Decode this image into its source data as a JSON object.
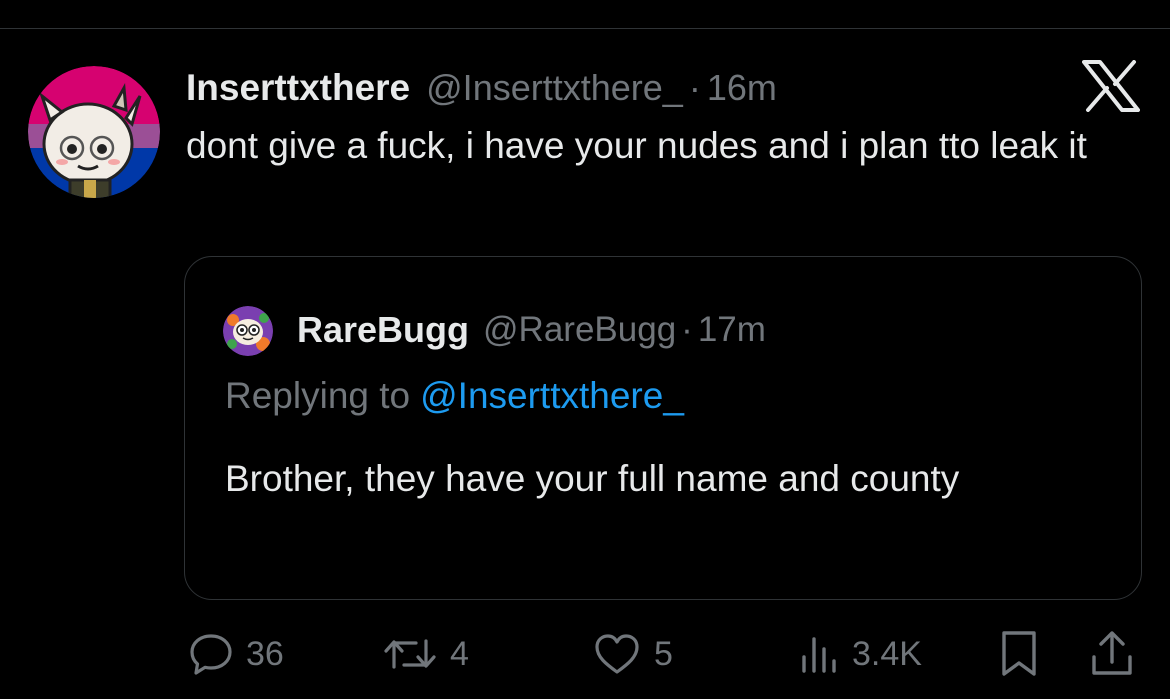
{
  "tweet": {
    "display_name": "Inserttxthere",
    "handle": "@Inserttxthere_",
    "separator": "·",
    "time": "16m",
    "text": "dont give a fuck, i have your nudes and i plan tto leak it"
  },
  "quoted_tweet": {
    "display_name": "RareBugg",
    "handle": "@RareBugg",
    "separator": "·",
    "time": "17m",
    "replying_prefix": "Replying to",
    "replying_handle": "@Inserttxthere_",
    "text": "Brother, they have your full name and county"
  },
  "actions": {
    "replies": "36",
    "reposts": "4",
    "likes": "5",
    "views": "3.4K"
  },
  "icons": {
    "logo": "x-logo-icon",
    "reply": "reply-icon",
    "repost": "repost-icon",
    "like": "heart-icon",
    "views": "views-icon",
    "bookmark": "bookmark-icon",
    "share": "share-icon"
  },
  "colors": {
    "background": "#000000",
    "primary_text": "#e7e9ea",
    "secondary_text": "#71767b",
    "link": "#1d9bf0",
    "border": "#2f3336"
  }
}
